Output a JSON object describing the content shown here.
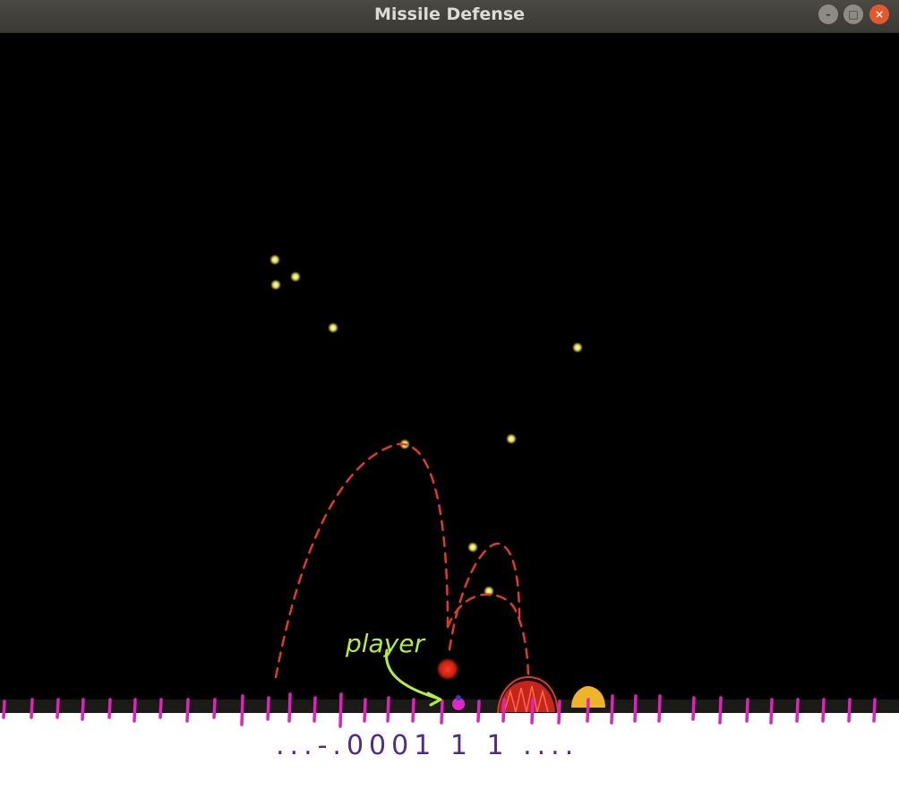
{
  "window": {
    "title": "Missile Defense",
    "buttons": {
      "minimize_icon": "minimize-icon",
      "maximize_icon": "maximize-icon",
      "close_icon": "close-icon",
      "minimize_glyph": "–",
      "maximize_glyph": "□",
      "close_glyph": "×"
    }
  },
  "game": {
    "colors": {
      "background": "#000000",
      "ground": "#1a1a16",
      "missile": "#e8e45a",
      "player": "#e026c8",
      "red_blob": "#d9281c",
      "base": "#f0b428",
      "trajectory": "#e03a22"
    },
    "missiles_visible": 10,
    "entities": [
      "missile",
      "player",
      "explosion",
      "base"
    ]
  },
  "annotations": {
    "player_label": "player",
    "bit_string": "...-.0001 1 1 ....",
    "tick_color": "#e020c0",
    "pen_color_label": "#b7ee3c",
    "pen_color_bits": "#4f2b8f"
  }
}
